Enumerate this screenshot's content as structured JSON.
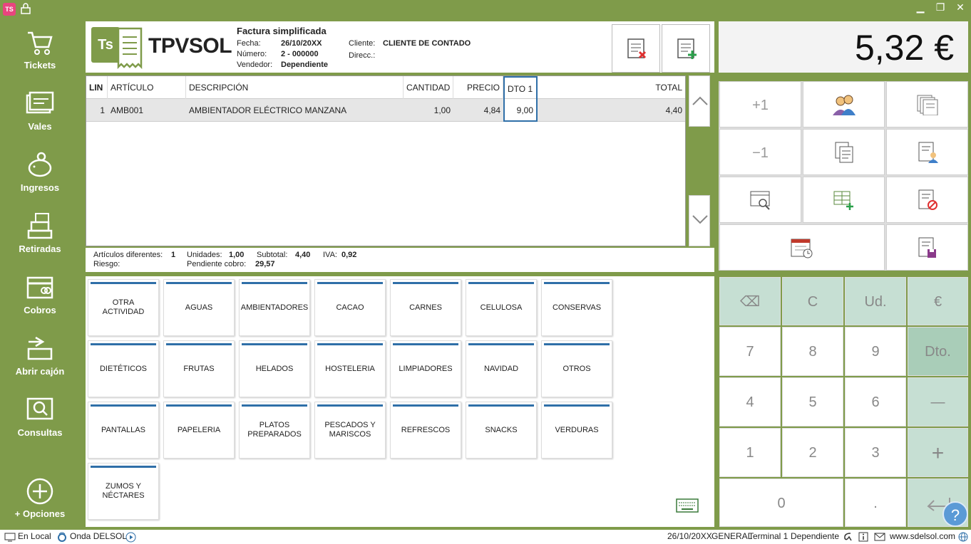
{
  "app": {
    "icon_text": "TS"
  },
  "window": {
    "minimize": "▁",
    "restore": "❐",
    "close": "✕"
  },
  "sidebar": {
    "items": [
      {
        "label": "Tickets",
        "icon": "cart-icon"
      },
      {
        "label": "Vales",
        "icon": "voucher-icon"
      },
      {
        "label": "Ingresos",
        "icon": "piggy-bank-icon"
      },
      {
        "label": "Retiradas",
        "icon": "register-icon"
      },
      {
        "label": "Cobros",
        "icon": "card-icon"
      },
      {
        "label": "Abrir cajón",
        "icon": "drawer-icon"
      },
      {
        "label": "Consultas",
        "icon": "search-icon"
      }
    ],
    "options_label": "+ Opciones"
  },
  "header": {
    "logo_badge": "Ts",
    "logo_text": "TPVSOL",
    "doc_title": "Factura simplificada",
    "fecha_label": "Fecha:",
    "fecha": "26/10/20XX",
    "numero_label": "Número:",
    "numero": "2 - 000000",
    "vendedor_label": "Vendedor:",
    "vendedor": "Dependiente",
    "cliente_label": "Cliente:",
    "cliente": "CLIENTE DE CONTADO",
    "direcc_label": "Direcc.:"
  },
  "total": {
    "amount": "5,32 €"
  },
  "table": {
    "headers": [
      "LIN",
      "ARTÍCULO",
      "DESCRIPCIÓN",
      "CANTIDAD",
      "PRECIO",
      "DTO 1",
      "TOTAL"
    ],
    "rows": [
      {
        "lin": "1",
        "articulo": "AMB001",
        "descripcion": "AMBIENTADOR ELÉCTRICO MANZANA",
        "cantidad": "1,00",
        "precio": "4,84",
        "dto": "9,00",
        "total": "4,40"
      }
    ]
  },
  "summary": {
    "articulos_label": "Artículos diferentes:",
    "articulos": "1",
    "unidades_label": "Unidades:",
    "unidades": "1,00",
    "subtotal_label": "Subtotal:",
    "subtotal": "4,40",
    "iva_label": "IVA:",
    "iva": "0,92",
    "riesgo_label": "Riesgo:",
    "pendiente_label": "Pendiente cobro:",
    "pendiente": "29,57"
  },
  "actions": {
    "plus_one": "+1",
    "minus_one": "−1"
  },
  "families": [
    "OTRA ACTIVIDAD",
    "AGUAS",
    "AMBIENTADORES",
    "CACAO",
    "CARNES",
    "CELULOSA",
    "CONSERVAS",
    "DIETÉTICOS",
    "FRUTAS",
    "HELADOS",
    "HOSTELERIA",
    "LIMPIADORES",
    "NAVIDAD",
    "OTROS",
    "PANTALLAS",
    "PAPELERIA",
    "PLATOS PREPARADOS",
    "PESCADOS Y MARISCOS",
    "REFRESCOS",
    "SNACKS",
    "VERDURAS",
    "ZUMOS Y NÉCTARES"
  ],
  "keypad": {
    "backspace": "⌫",
    "clear": "C",
    "units": "Ud.",
    "euro": "€",
    "k7": "7",
    "k8": "8",
    "k9": "9",
    "dto": "Dto.",
    "k4": "4",
    "k5": "5",
    "k6": "6",
    "minus": "—",
    "k1": "1",
    "k2": "2",
    "k3": "3",
    "plus": "+",
    "k0": "0",
    "dot": "."
  },
  "status": {
    "local": "En Local",
    "radio": "Onda DELSOL",
    "date": "26/10/20XX",
    "general": "GENERAL",
    "terminal": "Terminal 1",
    "user": "Dependiente",
    "web": "www.sdelsol.com"
  },
  "help": "?",
  "colors": {
    "brand_green": "#7f9b4a",
    "accent_blue": "#2f6fa8",
    "keypad_green": "#c6dfd3"
  }
}
